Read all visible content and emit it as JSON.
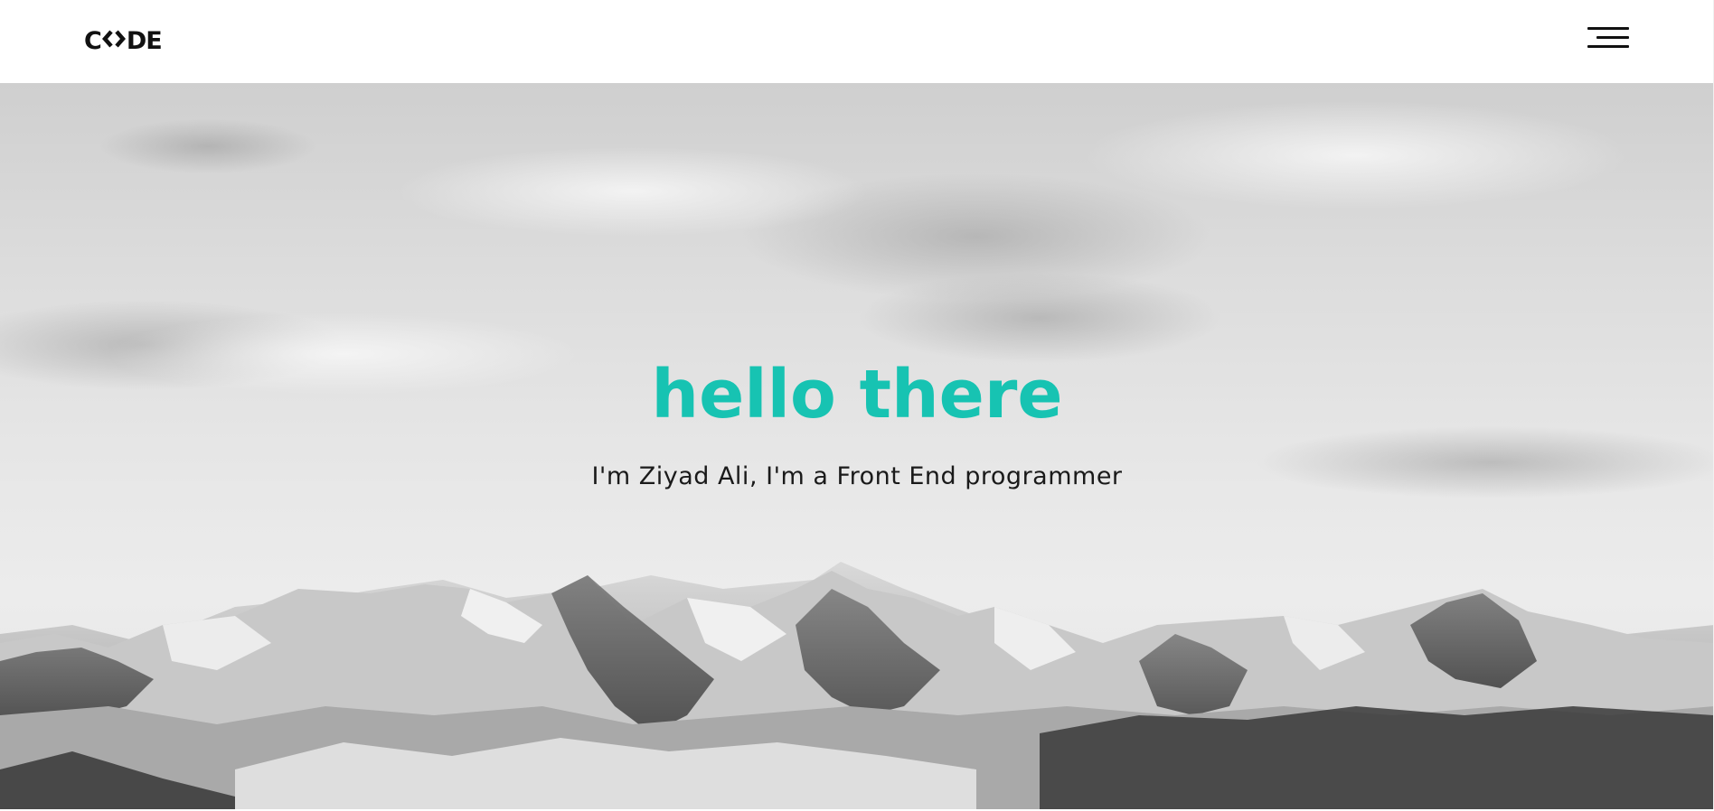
{
  "header": {
    "logo_left": "C",
    "logo_right": "DE",
    "logo_alt": "CODE"
  },
  "hero": {
    "title": "hello there",
    "subtitle": "I'm Ziyad Ali, I'm a Front End programmer"
  },
  "icons": {
    "menu": "hamburger-menu-icon",
    "logo_mark": "code-chevrons-icon"
  },
  "colors": {
    "accent": "#17c3b2",
    "text": "#1a1a1a",
    "header_bg": "#ffffff"
  }
}
